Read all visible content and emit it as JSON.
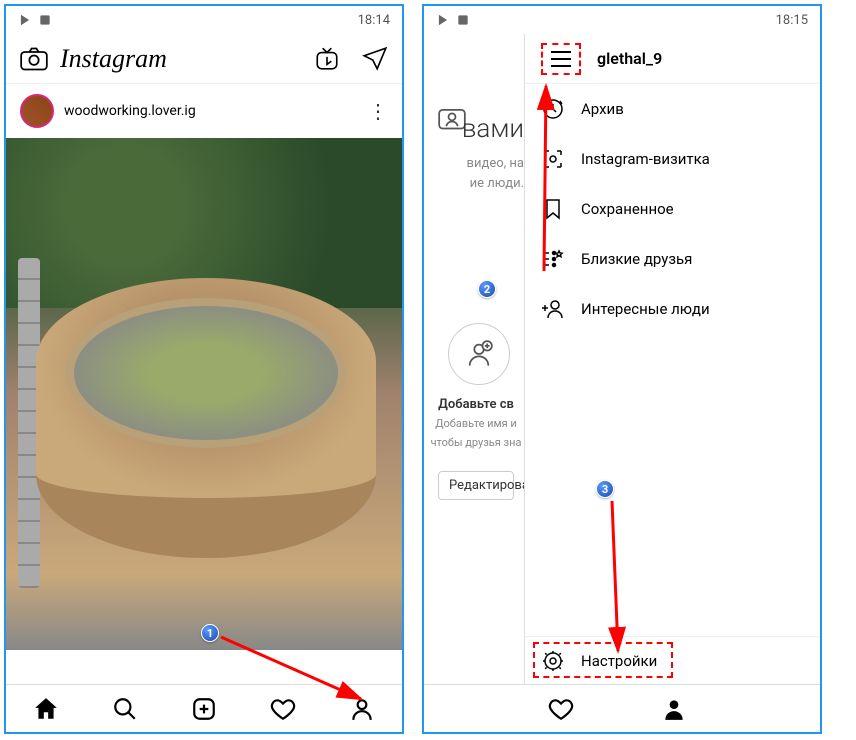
{
  "left": {
    "status_time": "18:14",
    "logo_text": "Instagram",
    "post_username": "woodworking.lover.ig"
  },
  "right": {
    "status_time": "18:15",
    "back_title": "вами",
    "back_line1": "видео, на",
    "back_line2": "ие люди.",
    "add_own": "Добавьте св",
    "add_desc1": "Добавьте имя и",
    "add_desc2": "чтобы друзья зна",
    "edit_label": "Редактирова",
    "drawer": {
      "username": "glethal_9",
      "items": [
        {
          "label": "Архив"
        },
        {
          "label": "Instagram-визитка"
        },
        {
          "label": "Сохраненное"
        },
        {
          "label": "Близкие друзья"
        },
        {
          "label": "Интересные люди"
        }
      ],
      "settings": "Настройки"
    }
  },
  "badges": {
    "one": "1",
    "two": "2",
    "three": "3"
  }
}
